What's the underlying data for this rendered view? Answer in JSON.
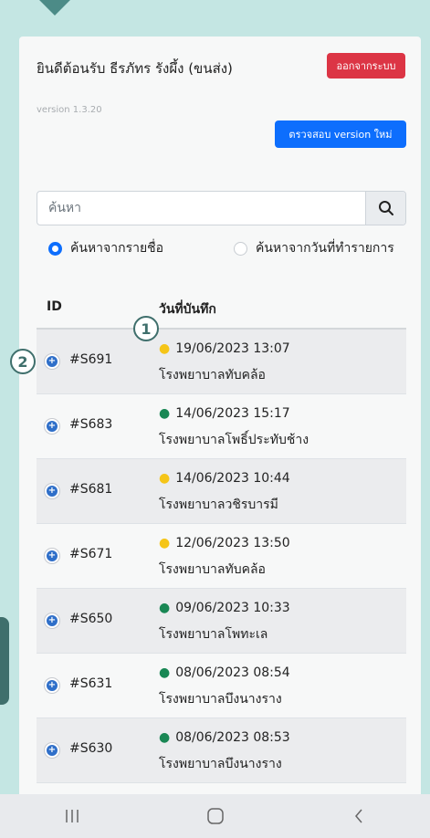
{
  "header": {
    "welcome": "ยินดีต้อนรับ ธีรภัทร รังผึ้ง (ขนส่ง)",
    "version": "version 1.3.20",
    "logout_label": "ออกจากระบบ",
    "check_version_label": "ตรวจสอบ version ใหม่"
  },
  "search": {
    "placeholder": "ค้นหา",
    "icon": "search-icon"
  },
  "filters": {
    "by_name": "ค้นหาจากรายชื่อ",
    "by_date": "ค้นหาจากวันที่ทำรายการ",
    "selected": "by_name"
  },
  "table": {
    "headers": {
      "id": "ID",
      "date": "วันที่บันทึก"
    },
    "rows": [
      {
        "id": "#S691",
        "date": "19/06/2023 13:07",
        "hospital": "โรงพยาบาลทับคล้อ",
        "status_color": "#f5c518"
      },
      {
        "id": "#S683",
        "date": "14/06/2023 15:17",
        "hospital": "โรงพยาบาลโพธิ์ประทับช้าง",
        "status_color": "#198754"
      },
      {
        "id": "#S681",
        "date": "14/06/2023 10:44",
        "hospital": "โรงพยาบาลวชิรบารมี",
        "status_color": "#f5c518"
      },
      {
        "id": "#S671",
        "date": "12/06/2023 13:50",
        "hospital": "โรงพยาบาลทับคล้อ",
        "status_color": "#f5c518"
      },
      {
        "id": "#S650",
        "date": "09/06/2023 10:33",
        "hospital": "โรงพยาบาลโพทะเล",
        "status_color": "#198754"
      },
      {
        "id": "#S631",
        "date": "08/06/2023 08:54",
        "hospital": "โรงพยาบาลบึงนางราง",
        "status_color": "#198754"
      },
      {
        "id": "#S630",
        "date": "08/06/2023 08:53",
        "hospital": "โรงพยาบาลบึงนางราง",
        "status_color": "#198754"
      }
    ]
  },
  "callouts": [
    "1",
    "2"
  ],
  "colors": {
    "danger": "#dc3545",
    "primary": "#0d6efd",
    "accent": "#3f6f6c"
  }
}
